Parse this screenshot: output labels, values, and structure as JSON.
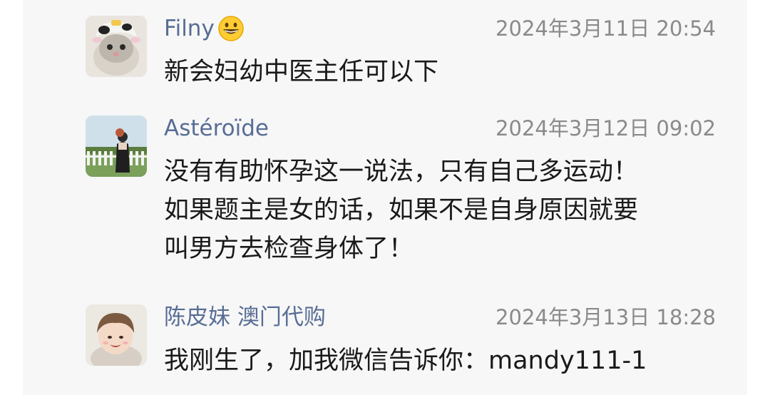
{
  "comments": [
    {
      "author": "Filny",
      "emoji": "grinning-face-emoji",
      "time": "2024年3月11日 20:54",
      "lines": [
        "新会妇幼中医主任可以下"
      ]
    },
    {
      "author": "Astéroïde",
      "time": "2024年3月12日 09:02",
      "lines": [
        "没有有助怀孕这一说法，只有自己多运动！",
        "如果题主是女的话，如果不是自身原因就要",
        "叫男方去检查身体了！"
      ]
    },
    {
      "author": "陈皮妹 澳门代购",
      "time": "2024年3月13日 18:28",
      "lines": [
        "我刚生了，加我微信告诉你：mandy111-1"
      ]
    }
  ],
  "colors": {
    "name": "#586d95",
    "time": "#8a8a8a",
    "text": "#1a1a1a",
    "panel": "#f7f7f7"
  }
}
